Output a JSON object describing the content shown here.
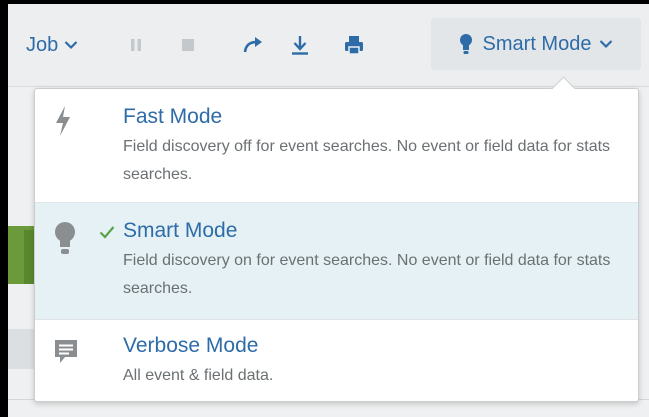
{
  "toolbar": {
    "job_label": "Job",
    "mode_label": "Smart Mode",
    "icons": [
      "chevron-down-icon",
      "pause-icon",
      "stop-icon",
      "share-icon",
      "export-icon",
      "print-icon",
      "lightbulb-icon"
    ]
  },
  "mode_menu": {
    "options": [
      {
        "title": "Fast Mode",
        "description": "Field discovery off for event searches. No event or field data for stats searches.",
        "icon": "lightning-bolt-icon",
        "selected": false
      },
      {
        "title": "Smart Mode",
        "description": "Field discovery on for event searches. No event or field data for stats searches.",
        "icon": "lightbulb-icon",
        "selected": true
      },
      {
        "title": "Verbose Mode",
        "description": "All event & field data.",
        "icon": "speech-bubble-icon",
        "selected": false
      }
    ]
  },
  "colors": {
    "accent": "#2e6ca8",
    "selected_bg": "#e5f1f4",
    "check": "#5aa14a",
    "muted_text": "#6b7073",
    "icon_gray": "#8a8e91"
  }
}
